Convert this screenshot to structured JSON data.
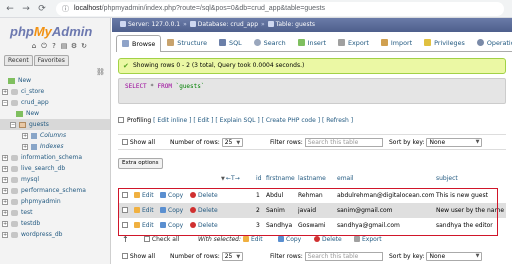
{
  "browser": {
    "url_host": "localhost",
    "url_path": "/phpmyadmin/index.php?route=/sql&pos=0&db=crud_app&table=guests"
  },
  "sidebar": {
    "logo": {
      "php": "php",
      "my": "My",
      "admin": "Admin"
    },
    "tabs": [
      "Recent",
      "Favorites"
    ],
    "tree": {
      "new_root": "New",
      "ci_store": "ci_store",
      "crud_app": "crud_app",
      "new_db": "New",
      "guests": "guests",
      "columns": "Columns",
      "indexes": "Indexes",
      "information_schema": "information_schema",
      "live_search_db": "live_search_db",
      "mysql": "mysql",
      "performance_schema": "performance_schema",
      "phpmyadmin": "phpmyadmin",
      "test": "test",
      "testdb": "testdb",
      "wordpress_db": "wordpress_db"
    }
  },
  "breadcrumb": {
    "server": "Server: 127.0.0.1",
    "database": "Database: crud_app",
    "table": "Table: guests"
  },
  "tabs": {
    "browse": "Browse",
    "structure": "Structure",
    "sql": "SQL",
    "search": "Search",
    "insert": "Insert",
    "export": "Export",
    "import": "Import",
    "privileges": "Privileges",
    "operations": "Operation"
  },
  "success_message": "Showing rows 0 - 2 (3 total, Query took 0.0004 seconds.)",
  "sql_query": {
    "select": "SELECT",
    "star": " * ",
    "from": "FROM",
    "table": " `guests`"
  },
  "profiling": {
    "label": "Profiling",
    "links": "[ Edit inline ] [ Edit ] [ Explain SQL ] [ Create PHP code ] [ Refresh ]"
  },
  "controls": {
    "show_all": "Show all",
    "rows_label": "Number of rows:",
    "rows_value": "25",
    "filter_label": "Filter rows:",
    "filter_placeholder": "Search this table",
    "sort_label": "Sort by key:",
    "sort_value": "None"
  },
  "extra_options": "Extra options",
  "table": {
    "headers": {
      "arrows": "←T→",
      "id": "id",
      "firstname": "firstname",
      "lastname": "lastname",
      "email": "email",
      "subject": "subject"
    },
    "actions": {
      "edit": "Edit",
      "copy": "Copy",
      "delete": "Delete"
    },
    "rows": [
      {
        "id": "1",
        "firstname": "Abdul",
        "lastname": "Rehman",
        "email": "abdulrehman@digitalocean.com",
        "subject": "This is new guest"
      },
      {
        "id": "2",
        "firstname": "Sanim",
        "lastname": "javaid",
        "email": "sanim@gmail.com",
        "subject": "New user by the name of Sanim"
      },
      {
        "id": "3",
        "firstname": "Sandhya",
        "lastname": "Goswami",
        "email": "sandhya@gmail.com",
        "subject": "sandhya the editor"
      }
    ]
  },
  "bottom": {
    "check_all": "Check all",
    "with_selected": "With selected:",
    "edit": "Edit",
    "copy": "Copy",
    "delete": "Delete",
    "export": "Export"
  }
}
